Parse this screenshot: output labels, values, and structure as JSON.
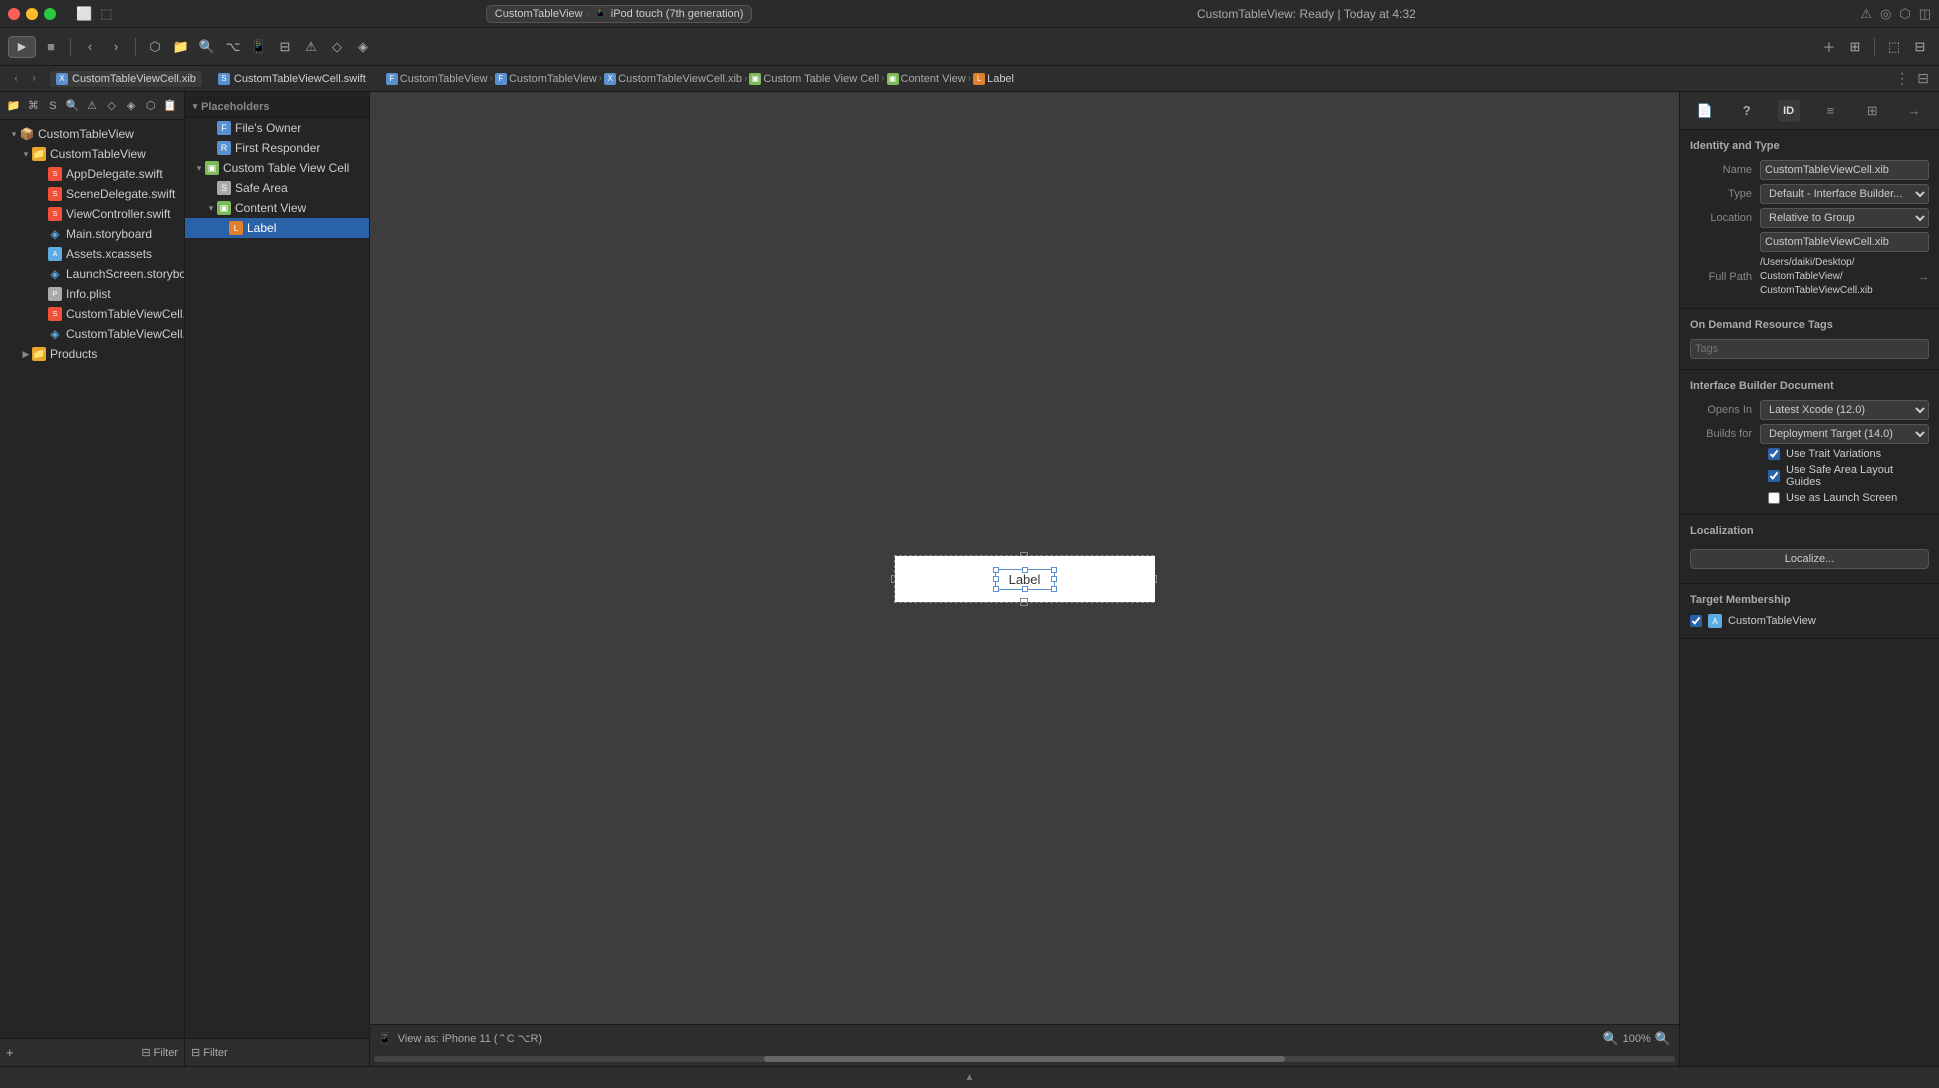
{
  "titleBar": {
    "appName": "CustomTableView",
    "deviceName": "iPod touch (7th generation)",
    "statusText": "CustomTableView: Ready | Today at 4:32"
  },
  "toolbar": {
    "runLabel": "▶",
    "stopLabel": "■"
  },
  "tabs": {
    "xib": "CustomTableViewCell.xib",
    "swift": "CustomTableViewCell.swift"
  },
  "breadcrumb": {
    "items": [
      {
        "label": "CustomTableView",
        "type": "folder"
      },
      {
        "label": "CustomTableView",
        "type": "folder"
      },
      {
        "label": "CustomTableViewCell.xib",
        "type": "xib"
      },
      {
        "label": "Custom Table View Cell",
        "type": "view"
      },
      {
        "label": "Content View",
        "type": "view"
      },
      {
        "label": "Label",
        "type": "label"
      }
    ]
  },
  "navigator": {
    "footerFilter": "Filter",
    "items": [
      {
        "id": "customtableview-group",
        "label": "CustomTableView",
        "type": "group",
        "indent": 0,
        "expanded": true,
        "toggle": "▾"
      },
      {
        "id": "customtableview-folder",
        "label": "CustomTableView",
        "type": "folder",
        "indent": 1,
        "expanded": true,
        "toggle": "▾"
      },
      {
        "id": "appdelegate",
        "label": "AppDelegate.swift",
        "type": "swift",
        "indent": 2,
        "toggle": ""
      },
      {
        "id": "scenedelegate",
        "label": "SceneDelegate.swift",
        "type": "swift",
        "indent": 2,
        "toggle": ""
      },
      {
        "id": "viewcontroller",
        "label": "ViewController.swift",
        "type": "swift",
        "indent": 2,
        "toggle": ""
      },
      {
        "id": "mainstoryboard",
        "label": "Main.storyboard",
        "type": "storyboard",
        "indent": 2,
        "toggle": ""
      },
      {
        "id": "xcassets",
        "label": "Assets.xcassets",
        "type": "xcassets",
        "indent": 2,
        "toggle": ""
      },
      {
        "id": "launchscreen",
        "label": "LaunchScreen.storybo...",
        "type": "storyboard",
        "indent": 2,
        "toggle": ""
      },
      {
        "id": "infoplist",
        "label": "Info.plist",
        "type": "plist",
        "indent": 2,
        "toggle": ""
      },
      {
        "id": "customcell1",
        "label": "CustomTableViewCell....",
        "type": "swift",
        "indent": 2,
        "toggle": ""
      },
      {
        "id": "customcell2",
        "label": "CustomTableViewCell....",
        "type": "xib",
        "indent": 2,
        "toggle": ""
      },
      {
        "id": "products",
        "label": "Products",
        "type": "folder",
        "indent": 1,
        "expanded": false,
        "toggle": "▶"
      }
    ]
  },
  "outline": {
    "sections": [
      {
        "title": "Placeholders",
        "items": [
          {
            "label": "File's Owner",
            "type": "placeholder",
            "indent": 0,
            "toggle": ""
          },
          {
            "label": "First Responder",
            "type": "placeholder",
            "indent": 0,
            "toggle": ""
          }
        ]
      }
    ],
    "items": [
      {
        "label": "Custom Table View Cell",
        "type": "cell",
        "indent": 0,
        "expanded": true,
        "toggle": "▾"
      },
      {
        "label": "Safe Area",
        "type": "safearea",
        "indent": 1,
        "expanded": false,
        "toggle": ""
      },
      {
        "label": "Content View",
        "type": "view",
        "indent": 1,
        "expanded": true,
        "toggle": "▾"
      },
      {
        "label": "Label",
        "type": "label",
        "indent": 2,
        "toggle": "",
        "selected": true
      }
    ],
    "footerFilter": "Filter"
  },
  "canvas": {
    "labelText": "Label",
    "zoomLevel": "100%",
    "viewAs": "View as: iPhone 11 (⌃C ⌥R)"
  },
  "inspector": {
    "activeTab": "identity",
    "sections": {
      "identityAndType": {
        "title": "Identity and Type",
        "name": {
          "label": "Name",
          "value": "CustomTableViewCell.xib"
        },
        "type": {
          "label": "Type",
          "value": "Default - Interface Builder..."
        },
        "location": {
          "label": "Location",
          "value": "Relative to Group"
        },
        "fullPath": {
          "label": "Full Path",
          "value": "/Users/daiki/Desktop/CustomTableView/CustomTableViewCell.xib",
          "icon": "→"
        }
      },
      "onDemandResourceTags": {
        "title": "On Demand Resource Tags",
        "placeholder": "Tags"
      },
      "interfaceBuilderDocument": {
        "title": "Interface Builder Document",
        "opensIn": {
          "label": "Opens In",
          "value": "Latest Xcode (12.0)"
        },
        "buildsFor": {
          "label": "Builds for",
          "value": "Deployment Target (14.0)"
        },
        "checkboxes": [
          {
            "label": "Use Trait Variations",
            "checked": true
          },
          {
            "label": "Use Safe Area Layout Guides",
            "checked": true
          },
          {
            "label": "Use as Launch Screen",
            "checked": false
          }
        ]
      },
      "localization": {
        "title": "Localization",
        "buttonLabel": "Localize..."
      },
      "targetMembership": {
        "title": "Target Membership",
        "targets": [
          {
            "name": "CustomTableView",
            "checked": true
          }
        ]
      }
    },
    "tabs": [
      {
        "id": "file",
        "icon": "📄",
        "label": "file-tab"
      },
      {
        "id": "quickhelp",
        "icon": "?",
        "label": "quickhelp-tab"
      },
      {
        "id": "identity",
        "icon": "🪪",
        "label": "identity-tab",
        "active": true
      },
      {
        "id": "attributes",
        "icon": "≡",
        "label": "attributes-tab"
      },
      {
        "id": "size",
        "icon": "⊞",
        "label": "size-tab"
      },
      {
        "id": "connections",
        "icon": "→",
        "label": "connections-tab"
      }
    ]
  }
}
